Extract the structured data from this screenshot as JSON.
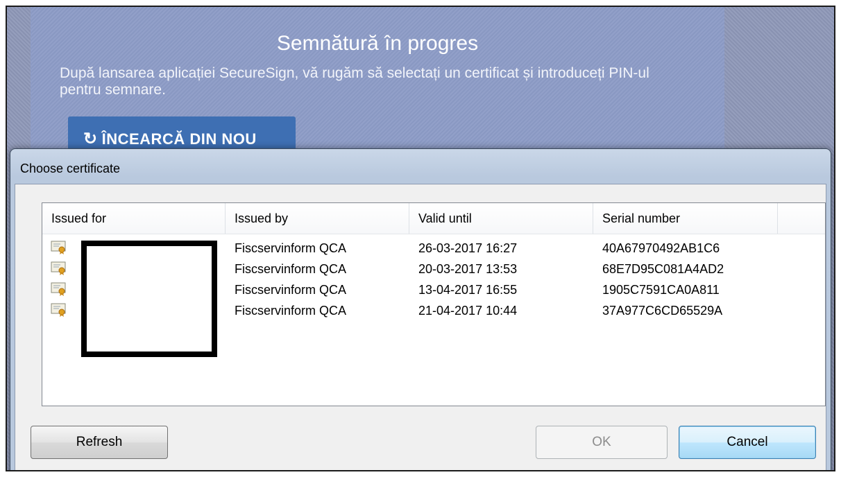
{
  "background_page": {
    "title": "Semnătură în progres",
    "message": "După lansarea aplicației SecureSign, vă rugăm să selectați un certificat și introduceți PIN-ul pentru semnare.",
    "retry_icon": "refresh-icon",
    "retry_label": "ÎNCEARCĂ DIN NOU"
  },
  "dialog": {
    "title": "Choose certificate",
    "columns": [
      "Issued for",
      "Issued by",
      "Valid until",
      "Serial number"
    ],
    "rows": [
      {
        "issued_for": "",
        "issued_by": "Fiscservinform QCA",
        "valid_until": "26-03-2017 16:27",
        "serial": "40A67970492AB1C6"
      },
      {
        "issued_for": "",
        "issued_by": "Fiscservinform QCA",
        "valid_until": "20-03-2017 13:53",
        "serial": "68E7D95C081A4AD2"
      },
      {
        "issued_for": "",
        "issued_by": "Fiscservinform QCA",
        "valid_until": "13-04-2017 16:55",
        "serial": "1905C7591CA0A811"
      },
      {
        "issued_for": "",
        "issued_by": "Fiscservinform QCA",
        "valid_until": "21-04-2017 10:44",
        "serial": "37A977C6CD65529A"
      }
    ],
    "row_icon": "certificate-icon",
    "buttons": {
      "refresh": "Refresh",
      "ok": "OK",
      "cancel": "Cancel"
    }
  }
}
